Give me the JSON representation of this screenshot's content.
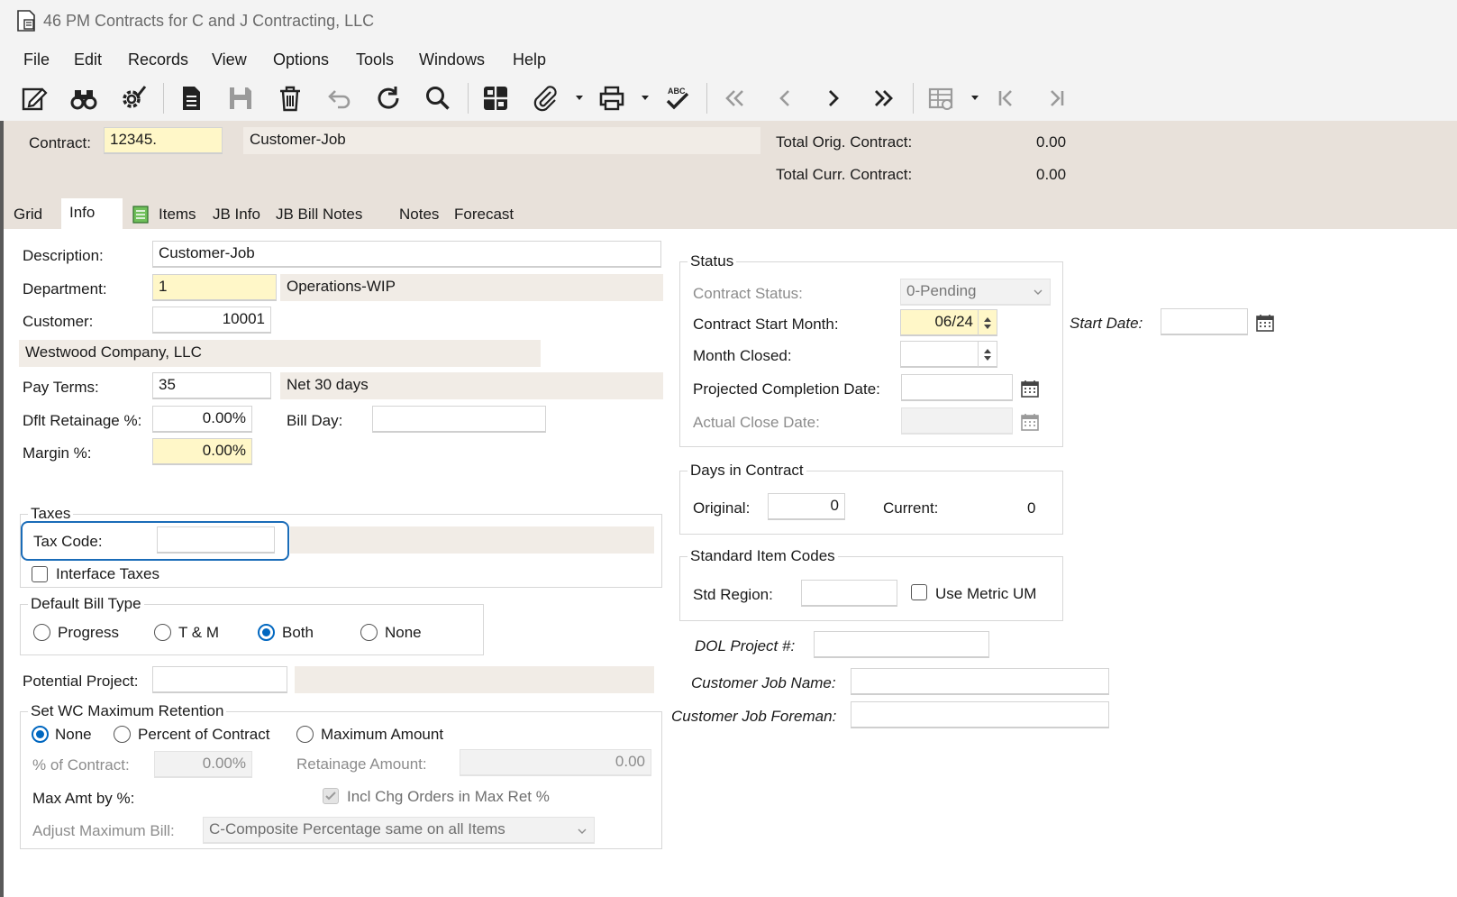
{
  "window": {
    "title": "46 PM Contracts for C and J Contracting, LLC"
  },
  "menu": [
    "File",
    "Edit",
    "Records",
    "View",
    "Options",
    "Tools",
    "Windows",
    "Help"
  ],
  "toolbar_icons": [
    "edit-icon",
    "binoculars-icon",
    "gear-check-icon",
    "new-document-icon",
    "save-icon",
    "delete-icon",
    "undo-icon",
    "refresh-icon",
    "search-icon",
    "grid-icon",
    "attachment-icon",
    "print-icon",
    "spellcheck-icon",
    "first-record-icon",
    "previous-record-icon",
    "next-record-icon",
    "last-record-icon",
    "table-settings-icon",
    "first-page-icon",
    "last-page-icon"
  ],
  "header": {
    "contract_label": "Contract:",
    "contract_value": "12345.",
    "contract_desc": "Customer-Job",
    "total_orig_label": "Total Orig. Contract:",
    "total_orig_value": "0.00",
    "total_curr_label": "Total Curr. Contract:",
    "total_curr_value": "0.00"
  },
  "tabs": [
    "Grid",
    "Info",
    "Items",
    "JB Info",
    "JB Bill Notes",
    "Notes",
    "Forecast"
  ],
  "active_tab": "Info",
  "info": {
    "description_label": "Description:",
    "description_value": "Customer-Job",
    "department_label": "Department:",
    "department_value": "1",
    "department_desc": "Operations-WIP",
    "customer_label": "Customer:",
    "customer_value": "10001",
    "customer_name": "Westwood Company, LLC",
    "pay_terms_label": "Pay Terms:",
    "pay_terms_value": "35",
    "pay_terms_desc": "Net 30 days",
    "retainage_label": "Dflt Retainage %:",
    "retainage_value": "0.00%",
    "bill_day_label": "Bill Day:",
    "bill_day_value": "",
    "margin_label": "Margin %:",
    "margin_value": "0.00%"
  },
  "taxes": {
    "title": "Taxes",
    "tax_code_label": "Tax Code:",
    "tax_code_value": "",
    "interface_taxes_label": "Interface Taxes",
    "interface_taxes_checked": false
  },
  "bill_type": {
    "title": "Default Bill Type",
    "options": [
      "Progress",
      "T & M",
      "Both",
      "None"
    ],
    "selected": "Both"
  },
  "potential_project": {
    "label": "Potential Project:",
    "value": ""
  },
  "wc_retention": {
    "title": "Set WC Maximum Retention",
    "options": [
      "None",
      "Percent of Contract",
      "Maximum Amount"
    ],
    "selected": "None",
    "pct_label": "% of Contract:",
    "pct_value": "0.00%",
    "ret_amount_label": "Retainage Amount:",
    "ret_amount_value": "0.00",
    "max_amt_label": "Max Amt by %:",
    "incl_chg_label": "Incl Chg Orders in Max Ret %",
    "adjust_label": "Adjust Maximum Bill:",
    "adjust_value": "C-Composite Percentage same on all Items"
  },
  "status": {
    "title": "Status",
    "contract_status_label": "Contract Status:",
    "contract_status_value": "0-Pending",
    "start_month_label": "Contract Start Month:",
    "start_month_value": "06/24",
    "month_closed_label": "Month Closed:",
    "month_closed_value": "",
    "projected_label": "Projected Completion Date:",
    "projected_value": "",
    "actual_close_label": "Actual Close Date:",
    "actual_close_value": ""
  },
  "start_date": {
    "label": "Start Date:",
    "value": ""
  },
  "days": {
    "title": "Days in Contract",
    "original_label": "Original:",
    "original_value": "0",
    "current_label": "Current:",
    "current_value": "0"
  },
  "std_codes": {
    "title": "Standard Item Codes",
    "region_label": "Std Region:",
    "region_value": "",
    "metric_label": "Use Metric UM",
    "metric_checked": false
  },
  "dol": {
    "label": "DOL Project #:",
    "value": ""
  },
  "job_name": {
    "label": "Customer Job Name:",
    "value": ""
  },
  "job_foreman": {
    "label": "Customer Job Foreman:",
    "value": ""
  },
  "colors": {
    "required_field": "#fff7c8",
    "readonly_field": "#f1ece6",
    "header_band": "#e8e1da",
    "accent": "#0067c0",
    "focus_outline": "#1a6cb8"
  }
}
